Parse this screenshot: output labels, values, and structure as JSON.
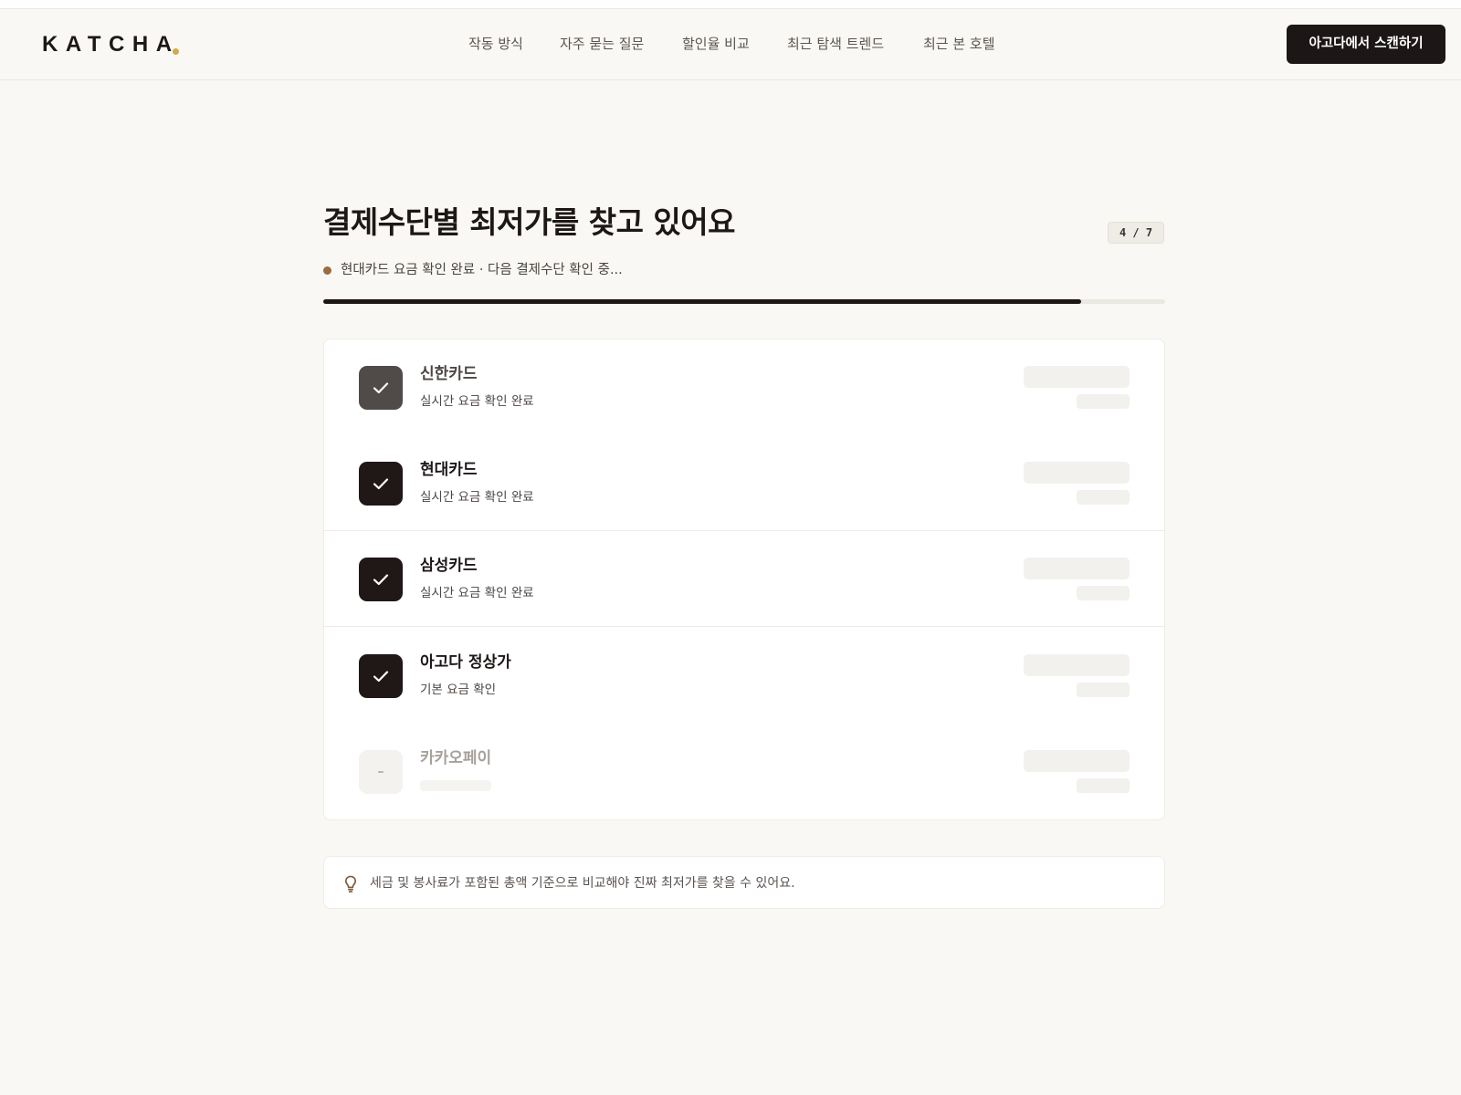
{
  "header": {
    "logo": "KATCHA",
    "nav": [
      {
        "label": "작동 방식"
      },
      {
        "label": "자주 묻는 질문"
      },
      {
        "label": "할인율 비교"
      },
      {
        "label": "최근 탐색 트렌드"
      },
      {
        "label": "최근 본 호텔"
      }
    ],
    "cta_label": "아고다에서 스캔하기"
  },
  "scan": {
    "title": "결제수단별 최저가를 찾고 있어요",
    "step": "4 / 7",
    "status_text": "현대카드 요금 확인 완료 · 다음 결제수단 확인 중...",
    "progress_percent": 90
  },
  "methods": [
    {
      "name": "신한카드",
      "detail": "실시간 요금 확인 완료",
      "state": "done"
    },
    {
      "name": "현대카드",
      "detail": "실시간 요금 확인 완료",
      "state": "done"
    },
    {
      "name": "삼성카드",
      "detail": "실시간 요금 확인 완료",
      "state": "done"
    },
    {
      "name": "아고다 정상가",
      "detail": "기본 요금 확인",
      "state": "done"
    },
    {
      "name": "카카오페이",
      "detail": "",
      "state": "pending"
    }
  ],
  "tip": {
    "icon": "lightbulb-icon",
    "text": "세금 및 봉사료가 포함된 총액 기준으로 비교해야 진짜 최저가를 찾을 수 있어요."
  },
  "colors": {
    "background": "#f9f8f4",
    "accent_dark": "#1c1716",
    "logo_dot": "#d2a84e",
    "status_dot": "#9b6b41"
  }
}
